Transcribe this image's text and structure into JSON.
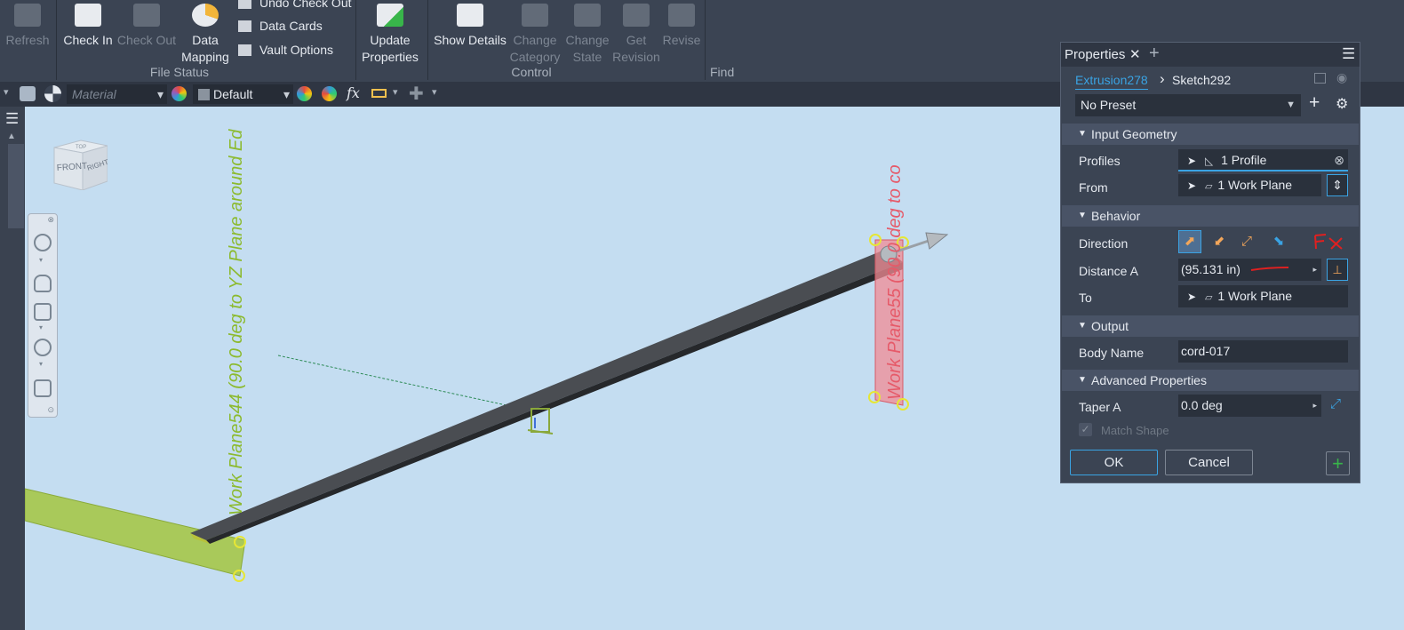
{
  "ribbon": {
    "refresh": "Refresh",
    "check_in": "Check In",
    "check_out": "Check Out",
    "data_mapping": [
      "Data",
      "Mapping"
    ],
    "undo_check_out": "Undo Check Out",
    "data_cards": "Data Cards",
    "vault_options": "Vault Options",
    "file_status": "File Status",
    "update_properties": [
      "Update",
      "Properties"
    ],
    "show_details": "Show Details",
    "change_category": [
      "Change",
      "Category"
    ],
    "change_state": [
      "Change",
      "State"
    ],
    "get_revision": [
      "Get",
      "Revision"
    ],
    "revise": "Revise",
    "control": "Control",
    "find": "Find"
  },
  "quick_access": {
    "material_placeholder": "Material",
    "appearance_value": "Default",
    "fx": "fx"
  },
  "viewcube": {
    "front": "FRONT",
    "right": "RIGHT",
    "top": "TOP"
  },
  "scene": {
    "plane_left_label": "Work Plane544 (90.0 deg to YZ Plane around Ed",
    "plane_right_label": "Work Plane55 (90.0 deg to co"
  },
  "properties": {
    "tab_title": "Properties",
    "breadcrumb_parent": "Extrusion278",
    "breadcrumb_child": "Sketch292",
    "preset": "No Preset",
    "sections": {
      "input_geometry": "Input Geometry",
      "behavior": "Behavior",
      "output": "Output",
      "advanced": "Advanced Properties"
    },
    "profiles_label": "Profiles",
    "profiles_value": "1 Profile",
    "from_label": "From",
    "from_value": "1 Work Plane",
    "direction_label": "Direction",
    "distance_label": "Distance A",
    "distance_value": "(95.131 in)",
    "to_label": "To",
    "to_value": "1 Work Plane",
    "body_name_label": "Body Name",
    "body_name_value": "cord-017",
    "taper_label": "Taper A",
    "taper_value": "0.0 deg",
    "match_shape_label": "Match Shape",
    "ok": "OK",
    "cancel": "Cancel"
  },
  "colors": {
    "ribbon_bg": "#3b4453",
    "viewport_bg": "#c4ddf1",
    "accent_blue": "#3aa3e3",
    "left_plane_green": "#9bc33a",
    "right_plane_red": "#f27d86",
    "add_green": "#38b54a"
  }
}
